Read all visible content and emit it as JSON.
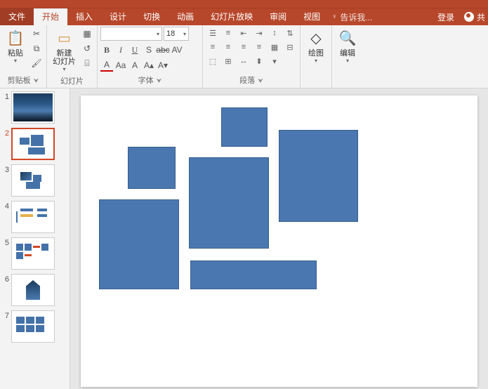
{
  "tabs": {
    "file": "文件",
    "home": "开始",
    "insert": "插入",
    "design": "设计",
    "transitions": "切换",
    "animations": "动画",
    "slideshow": "幻灯片放映",
    "review": "审阅",
    "view": "视图",
    "tellme": "告诉我...",
    "login": "登录",
    "share": "共"
  },
  "ribbon": {
    "clipboard": {
      "label": "剪贴板",
      "paste": "粘贴"
    },
    "slides": {
      "label": "幻灯片",
      "new_slide": "新建\n幻灯片"
    },
    "font": {
      "label": "字体",
      "font_name": "",
      "font_size": "18"
    },
    "paragraph": {
      "label": "段落"
    },
    "drawing": {
      "label": "绘图"
    },
    "editing": {
      "label": "编辑"
    }
  },
  "thumbs": [
    {
      "num": "1"
    },
    {
      "num": "2"
    },
    {
      "num": "3"
    },
    {
      "num": "4"
    },
    {
      "num": "5"
    },
    {
      "num": "6"
    },
    {
      "num": "7"
    }
  ],
  "colors": {
    "accent": "#b7472a",
    "shape_fill": "#4a77b0"
  }
}
